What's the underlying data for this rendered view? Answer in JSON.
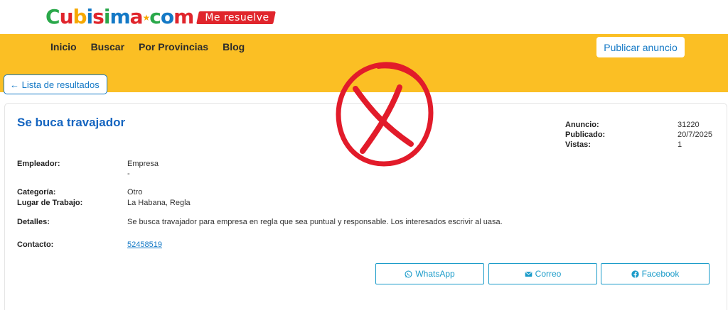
{
  "logo": {
    "letters": [
      "C",
      "u",
      "b",
      "i",
      "s",
      "i",
      "m",
      "a",
      "★",
      "c",
      "o",
      "m"
    ],
    "letter_colors": [
      "#2aa84a",
      "#e0252c",
      "#f6a800",
      "#1479c6",
      "#e0252c",
      "#2aa84a",
      "#1479c6",
      "#e0252c",
      "#f6a800",
      "#2aa84a",
      "#1479c6",
      "#e0252c"
    ],
    "tagline": "Me resuelve"
  },
  "nav": {
    "items": [
      "Inicio",
      "Buscar",
      "Por Provincias",
      "Blog"
    ],
    "publish_label": "Publicar anuncio"
  },
  "back_label": "← Lista de resultados",
  "listing": {
    "title": "Se buca travajador",
    "meta": [
      {
        "label": "Anuncio:",
        "value": "31220"
      },
      {
        "label": "Publicado:",
        "value": "20/7/2025"
      },
      {
        "label": "Vistas:",
        "value": "1"
      }
    ],
    "employer_label": "Empleador:",
    "employer_value": "Empresa",
    "employer_sub": "-",
    "category_label": "Categoría:",
    "category_value": "Otro",
    "workplace_label": "Lugar de Trabajo:",
    "workplace_value": "La Habana, Regla",
    "details_label": "Detalles:",
    "details_value": "Se busca travajador para empresa en regla que sea puntual y responsable. Los interesados escrivir al uasa.",
    "contact_label": "Contacto:",
    "contact_value": "52458519"
  },
  "share": {
    "whatsapp": "WhatsApp",
    "correo": "Correo",
    "facebook": "Facebook"
  },
  "colors": {
    "band": "#fbbf24",
    "accent": "#1479c6",
    "stamp": "#e21b2a"
  }
}
